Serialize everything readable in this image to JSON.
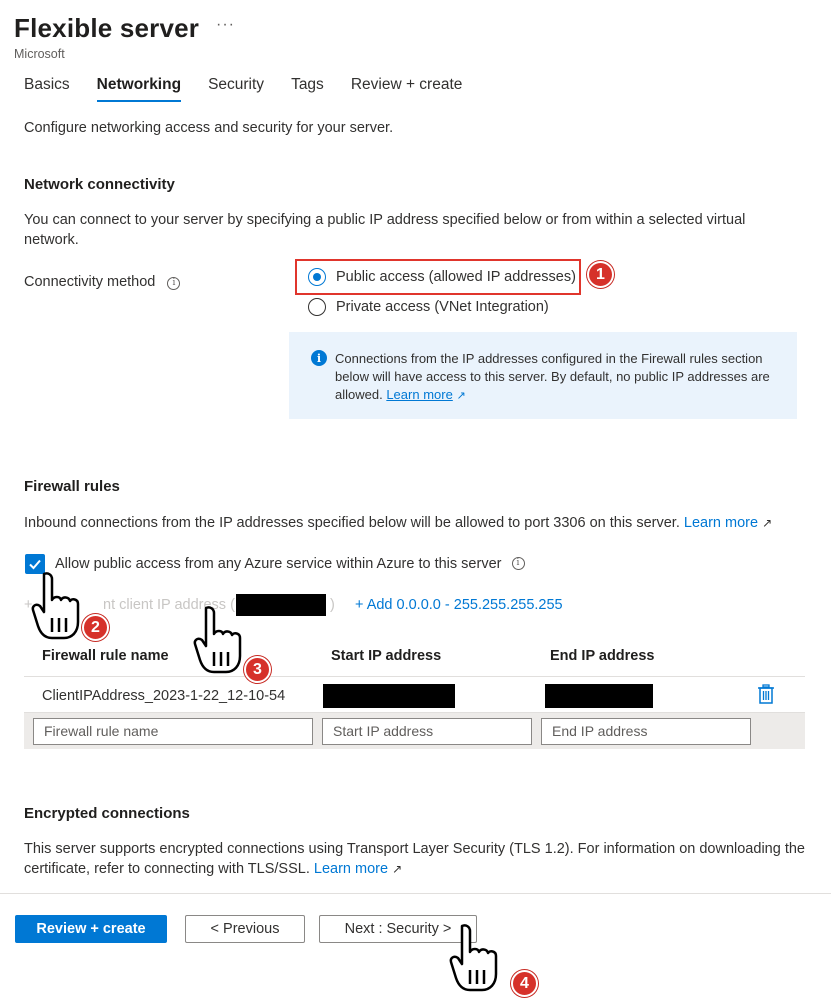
{
  "header": {
    "title": "Flexible server",
    "more": "···",
    "publisher": "Microsoft"
  },
  "tabs": [
    {
      "label": "Basics"
    },
    {
      "label": "Networking",
      "active": true
    },
    {
      "label": "Security"
    },
    {
      "label": "Tags"
    },
    {
      "label": "Review + create"
    }
  ],
  "intro": "Configure networking access and security for your server.",
  "network": {
    "heading": "Network connectivity",
    "description": "You can connect to your server by specifying a public IP address specified below or from within a selected virtual network.",
    "method_label": "Connectivity method",
    "options": [
      {
        "label": "Public access (allowed IP addresses)",
        "selected": true
      },
      {
        "label": "Private access (VNet Integration)",
        "selected": false
      }
    ],
    "info": "Connections from the IP addresses configured in the Firewall rules section below will have access to this server. By default, no public IP addresses are allowed.",
    "info_link": "Learn more"
  },
  "firewall": {
    "heading": "Firewall rules",
    "description": "Inbound connections from the IP addresses specified below will be allowed to port 3306 on this server.",
    "learn_more": "Learn more",
    "allow_azure": "Allow public access from any Azure service within Azure to this server",
    "add_client_prefix": "+",
    "add_client_visible": "nt client IP address (",
    "add_client_suffix": ")",
    "add_range": "+ Add 0.0.0.0 - 255.255.255.255",
    "columns": [
      "Firewall rule name",
      "Start IP address",
      "End IP address"
    ],
    "rows": [
      {
        "name": "ClientIPAddress_2023-1-22_12-10-54"
      }
    ],
    "placeholders": {
      "name": "Firewall rule name",
      "start": "Start IP address",
      "end": "End IP address"
    }
  },
  "encryption": {
    "heading": "Encrypted connections",
    "description": "This server supports encrypted connections using Transport Layer Security (TLS 1.2). For information on downloading the certificate, refer to connecting with TLS/SSL.",
    "learn_more": "Learn more"
  },
  "footer": {
    "review": "Review + create",
    "previous": "< Previous",
    "next": "Next : Security >"
  },
  "callouts": [
    "1",
    "2",
    "3",
    "4"
  ],
  "colors": {
    "accent": "#0078d4",
    "callout": "#d6312a",
    "highlight": "#e0352c"
  }
}
